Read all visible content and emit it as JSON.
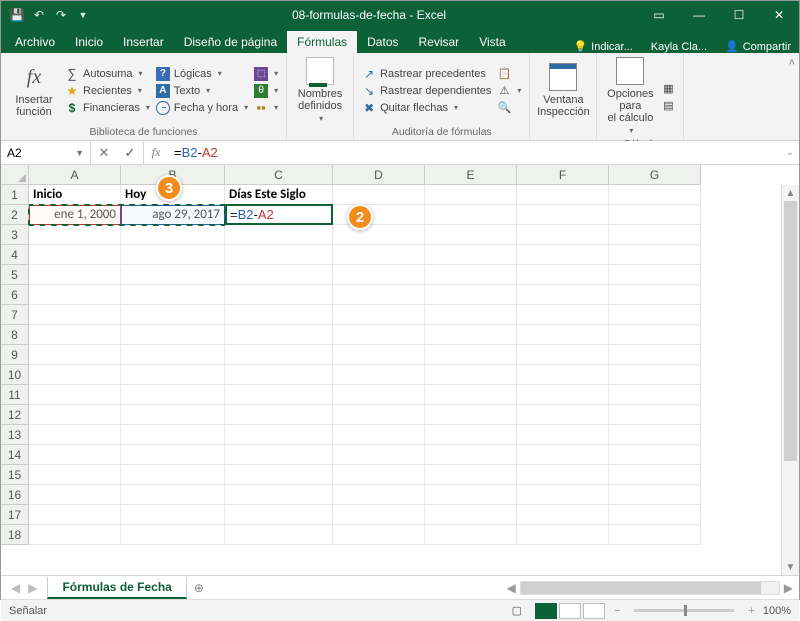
{
  "titlebar": {
    "title": "08-formulas-de-fecha - Excel"
  },
  "ribbonTabs": [
    "Archivo",
    "Inicio",
    "Insertar",
    "Diseño de página",
    "Fórmulas",
    "Datos",
    "Revisar",
    "Vista"
  ],
  "activeTab": "Fórmulas",
  "tell": "Indicar...",
  "user": "Kayla Cla...",
  "share": "Compartir",
  "ribbon": {
    "insertFn": {
      "l1": "Insertar",
      "l2": "función"
    },
    "lib": {
      "autosuma": "Autosuma",
      "recientes": "Recientes",
      "financieras": "Financieras",
      "logicas": "Lógicas",
      "texto": "Texto",
      "fecha": "Fecha y hora",
      "group": "Biblioteca de funciones"
    },
    "names": {
      "l1": "Nombres",
      "l2": "definidos"
    },
    "audit": {
      "prec": "Rastrear precedentes",
      "dep": "Rastrear dependientes",
      "quitar": "Quitar flechas",
      "group": "Auditoría de fórmulas"
    },
    "watch": {
      "l1": "Ventana",
      "l2": "Inspección"
    },
    "calc": {
      "l1": "Opciones para",
      "l2": "el cálculo",
      "group": "Cálculo"
    }
  },
  "formulaBar": {
    "name": "A2",
    "formula": "=B2-A2"
  },
  "columns": [
    "A",
    "B",
    "C",
    "D",
    "E",
    "F",
    "G"
  ],
  "rowNumbers": [
    1,
    2,
    3,
    4,
    5,
    6,
    7,
    8,
    9,
    10,
    11,
    12,
    13,
    14,
    15,
    16,
    17,
    18
  ],
  "headers": {
    "A": "Inicio",
    "B": "Hoy",
    "C": "Días Este Siglo"
  },
  "cells": {
    "A2": "ene 1, 2000",
    "B2": "ago 29, 2017"
  },
  "editCell": {
    "prefix": "=",
    "ref1": "B2",
    "op": "-",
    "ref2": "A2"
  },
  "callouts": {
    "c2": "2",
    "c3": "3"
  },
  "sheet": {
    "name": "Fórmulas de Fecha",
    "status": "Señalar",
    "zoom": "100%"
  }
}
